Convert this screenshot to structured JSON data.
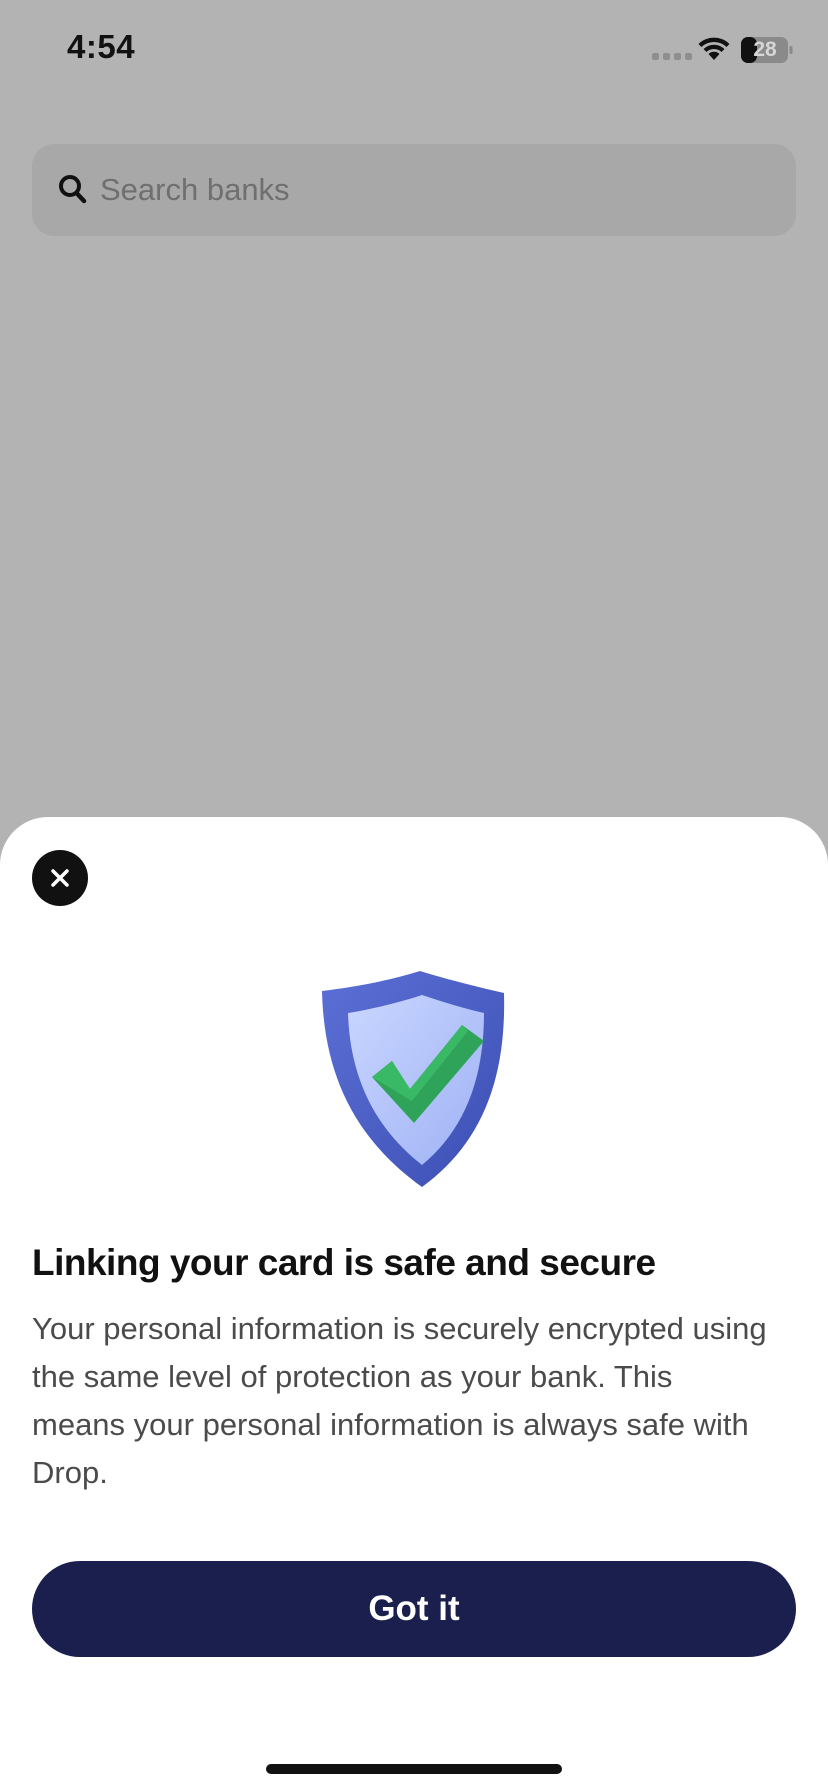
{
  "status_bar": {
    "time": "4:54",
    "battery_level": "28",
    "icons": [
      "cellular-signal-icon",
      "wifi-icon",
      "battery-icon"
    ]
  },
  "search": {
    "placeholder": "Search banks",
    "icon": "search-icon"
  },
  "sheet": {
    "close_icon": "close-icon",
    "illustration": "shield-check-icon",
    "title": "Linking your card is safe and secure",
    "body": "Your personal information is securely encrypted using the same level of protection as your bank. This means your personal information is always safe with Drop.",
    "primary_button_label": "Got it"
  },
  "colors": {
    "overlay_background": "#b3b3b3",
    "primary_button": "#1b1f4d",
    "shield_blue": "#4f63c9",
    "check_green": "#2fa35a"
  }
}
